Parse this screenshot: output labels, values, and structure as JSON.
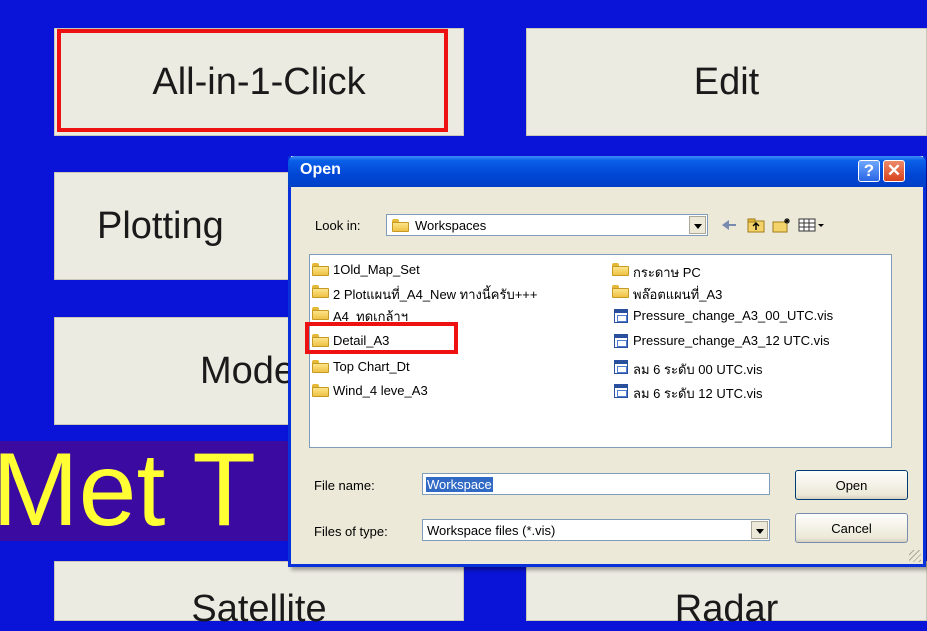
{
  "background": {
    "buttons": {
      "all_in_one": "All-in-1-Click",
      "edit": "Edit",
      "plotting": "Plotting",
      "model": "Mode",
      "satellite": "Satellite",
      "radar": "Radar"
    },
    "banner_text": "Met T"
  },
  "dialog": {
    "title": "Open",
    "help_glyph": "?",
    "close_glyph": "✕",
    "look_in_label": "Look in:",
    "look_in_value": "Workspaces",
    "files_col1": [
      {
        "name": "1Old_Map_Set",
        "icon": "folder-icon"
      },
      {
        "name": "2 Plotแผนที่_A4_New ทางนี้ครับ+++",
        "icon": "folder-icon"
      },
      {
        "name": "A4_ทดเกล้าฯ",
        "icon": "folder-icon"
      },
      {
        "name": "Detail_A3",
        "icon": "folder-icon"
      },
      {
        "name": "Top Chart_Dt",
        "icon": "folder-icon"
      },
      {
        "name": "Wind_4 leve_A3",
        "icon": "folder-icon"
      }
    ],
    "files_col2": [
      {
        "name": "กระดาษ PC",
        "icon": "folder-icon"
      },
      {
        "name": "พล๊อตแผนที่_A3",
        "icon": "folder-icon"
      },
      {
        "name": "Pressure_change_A3_00_UTC.vis",
        "icon": "vis-file-icon"
      },
      {
        "name": "Pressure_change_A3_12 UTC.vis",
        "icon": "vis-file-icon"
      },
      {
        "name": "ลม 6 ระดับ 00 UTC.vis",
        "icon": "vis-file-icon"
      },
      {
        "name": "ลม 6 ระดับ 12 UTC.vis",
        "icon": "vis-file-icon"
      }
    ],
    "file_name_label": "File name:",
    "file_name_value": "Workspace",
    "files_of_type_label": "Files of type:",
    "files_of_type_value": "Workspace files (*.vis)",
    "open_button": "Open",
    "cancel_button": "Cancel"
  },
  "colors": {
    "desktop_bg": "#0a14d8",
    "highlight": "#ee1111",
    "banner_text": "#ffff33",
    "xp_title_blue": "#0046d4"
  }
}
